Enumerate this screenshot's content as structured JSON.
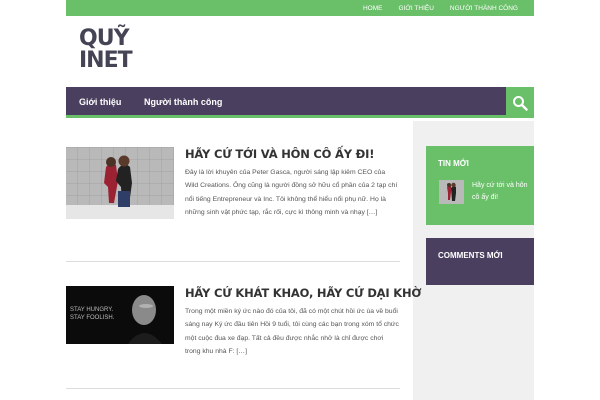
{
  "topnav": {
    "items": [
      "HOME",
      "GIỚI THIỆU",
      "NGƯỜI THÀNH CÔNG"
    ]
  },
  "logo": {
    "line1": "QUỸ",
    "line2": "INET"
  },
  "mainnav": {
    "items": [
      "Giới thiệu",
      "Người thành công"
    ]
  },
  "posts": [
    {
      "title": "HÃY CỨ TỚI VÀ HÔN CÔ ẤY ĐI!",
      "excerpt": "Đây là lời khuyên của Peter Gasca, người sáng lập kiêm CEO của Wild Creations. Ông cũng là người đồng sở hữu cổ phần của 2 tạp chí nổi tiếng Entrepreneur và Inc. Tôi không thể hiểu nổi phụ nữ. Họ là những sinh vật phức tạp, rắc rối, cực kì thông minh và nhạy […]"
    },
    {
      "title": "HÃY CỨ KHÁT KHAO, HÃY CỨ DẠI KHỜ",
      "excerpt": "Trong một miền ký ức nào đó của tôi, đã có một chút hồi ức ùa về buổi sáng nay Ký ức đầu tiên Hồi 9 tuổi, tôi cùng các bạn trong xóm tổ chức một cuộc đua xe đạp. Tất cả đều được nhắc nhở là chỉ được chơi trong khu nhà F: […]",
      "thumb_text_1": "STAY HUNGRY.",
      "thumb_text_2": "STAY FOOLISH."
    }
  ],
  "sidebar": {
    "widget1": {
      "title": "TIN MỚI",
      "post_title": "Hãy cứ tới và hôn cô ấy đi!"
    },
    "widget2": {
      "title": "COMMENTS MỚI"
    }
  },
  "colors": {
    "accent_green": "#6abf69",
    "nav_purple": "#4a3f5e",
    "text_dark": "#333333"
  },
  "icons": {
    "search": "search-icon"
  }
}
